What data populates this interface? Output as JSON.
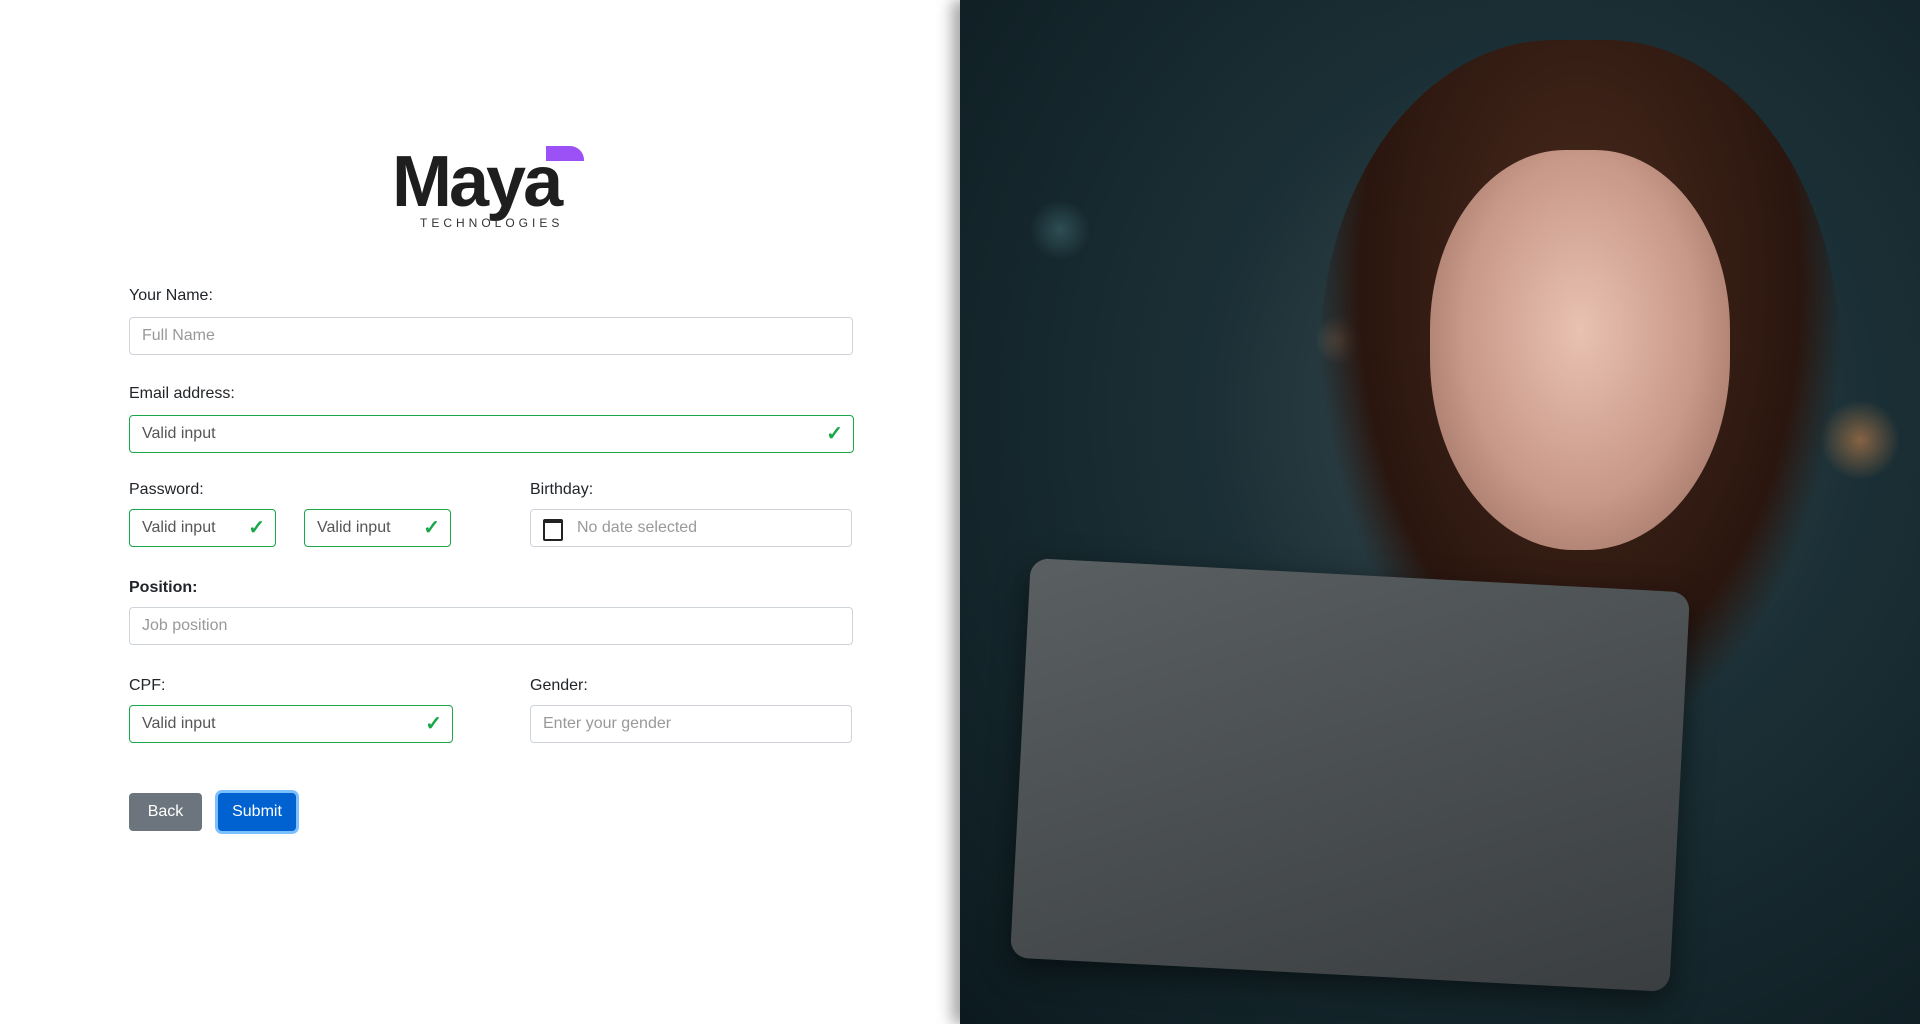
{
  "logo": {
    "name": "Maya",
    "sub": "TECHNOLOGIES",
    "accent": "#9b51f5"
  },
  "form": {
    "name": {
      "label": "Your Name:",
      "placeholder": "Full Name"
    },
    "email": {
      "label": "Email address:",
      "value": "Valid input"
    },
    "password": {
      "label": "Password:",
      "value1": "Valid input",
      "value2": "Valid input"
    },
    "birthday": {
      "label": "Birthday:",
      "placeholder": "No date selected"
    },
    "position": {
      "label": "Position:",
      "placeholder": "Job position"
    },
    "cpf": {
      "label": "CPF:",
      "value": "Valid input"
    },
    "gender": {
      "label": "Gender:",
      "placeholder": "Enter your gender"
    }
  },
  "buttons": {
    "back": "Back",
    "submit": "Submit"
  },
  "colors": {
    "valid": "#19a74a",
    "primary": "#0062d1",
    "secondary": "#6c757d"
  }
}
